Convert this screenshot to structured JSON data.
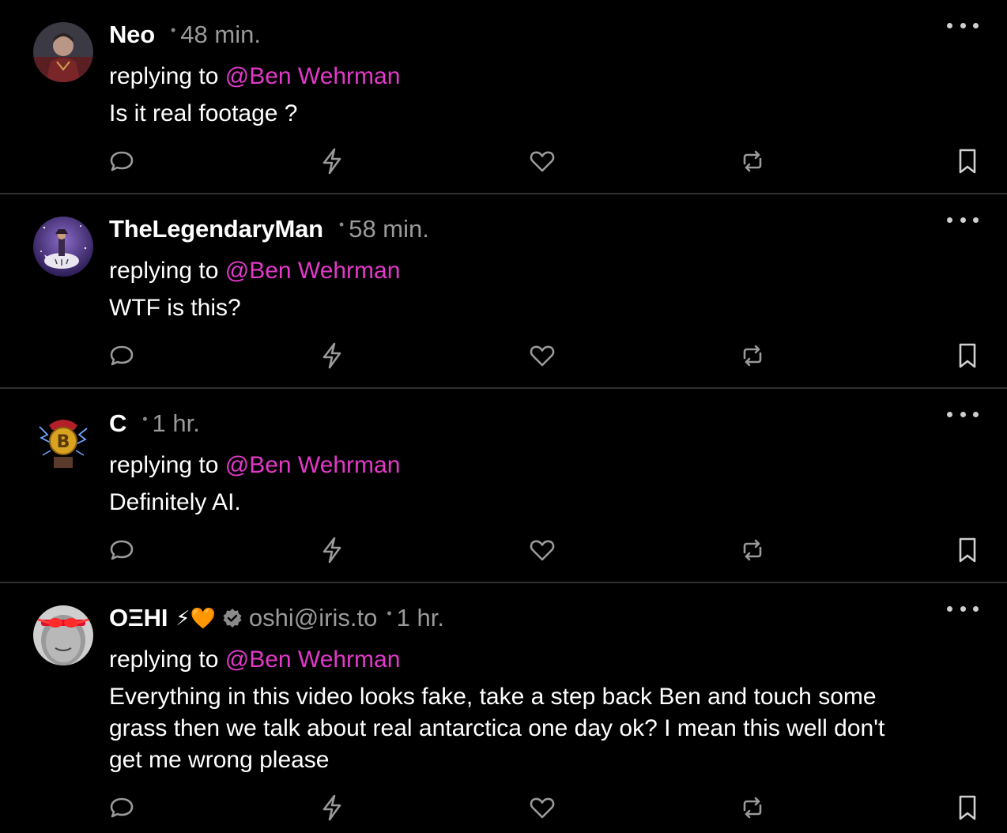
{
  "posts": [
    {
      "name": "Neo",
      "time": "48 min.",
      "reply_prefix": "replying to ",
      "reply_to": "@Ben Wehrman",
      "text": "Is it real footage ?",
      "avatar": "avatar-doctor-strange"
    },
    {
      "name": "TheLegendaryMan",
      "time": "58 min.",
      "reply_prefix": "replying to ",
      "reply_to": "@Ben Wehrman",
      "text": "WTF is this?",
      "avatar": "avatar-rider-on-white-tiger"
    },
    {
      "name": "C",
      "time": "1 hr.",
      "reply_prefix": "replying to ",
      "reply_to": "@Ben Wehrman",
      "text": "Definitely AI.",
      "avatar": "avatar-bitcoin-face"
    },
    {
      "name": "OΞHI",
      "name_emoji": "⚡🧡",
      "nip05": "oshi@iris.to",
      "time": "1 hr.",
      "reply_prefix": "replying to ",
      "reply_to": "@Ben Wehrman",
      "text": "Everything in this video looks fake, take a step back Ben and touch some grass then we talk about real antarctica one day ok? I mean this well don't get me wrong please",
      "avatar": "avatar-laser-eyes"
    }
  ],
  "icons": {
    "reply": "comment-icon",
    "zap": "zap-icon",
    "like": "heart-icon",
    "repost": "repost-icon",
    "bookmark": "bookmark-icon",
    "more": "more-options-icon",
    "verified": "verified-badge-icon"
  },
  "colors": {
    "background": "#000000",
    "mention": "#e339c9",
    "muted": "#9a9a9a",
    "divider": "#2f2f2f"
  }
}
